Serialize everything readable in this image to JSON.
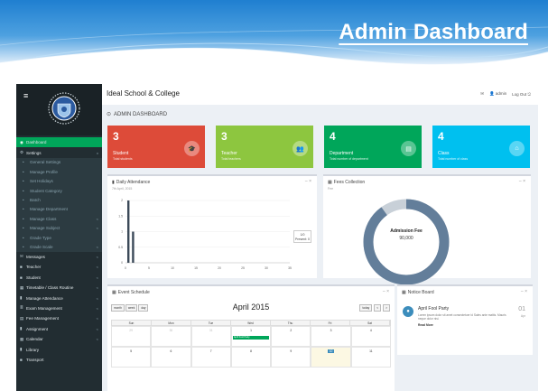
{
  "banner": {
    "title": "Admin Dashboard",
    "colors": {
      "top": "#1f7fd0",
      "bottom": "#e6f1fb"
    }
  },
  "app": {
    "school_name": "Ideal School & College",
    "page_title": "ADMIN DASHBOARD",
    "topbar": {
      "mail_icon": "envelope-icon",
      "user": "admin",
      "logout": "Log Out"
    }
  },
  "sidebar": {
    "items": [
      {
        "label": "Dashboard",
        "icon": "dashboard-icon",
        "state": "active"
      },
      {
        "label": "Settings",
        "icon": "gear-icon",
        "state": "open",
        "chevron": "v"
      },
      {
        "label": "General Settings",
        "sub": true
      },
      {
        "label": "Manage Profile",
        "sub": true
      },
      {
        "label": "Set Holidays",
        "sub": true
      },
      {
        "label": "Student Category",
        "sub": true
      },
      {
        "label": "Batch",
        "sub": true
      },
      {
        "label": "Manage Department",
        "sub": true
      },
      {
        "label": "Manage Class",
        "sub": true,
        "chevron": "<"
      },
      {
        "label": "Manage Subject",
        "sub": true,
        "chevron": "<"
      },
      {
        "label": "Grade Type",
        "sub": true
      },
      {
        "label": "Grade Scale",
        "sub": true,
        "chevron": "<"
      },
      {
        "label": "Messages",
        "icon": "envelope-icon",
        "chevron": "<"
      },
      {
        "label": "Teacher",
        "icon": "user-icon",
        "chevron": "<"
      },
      {
        "label": "Student",
        "icon": "users-icon",
        "chevron": "<"
      },
      {
        "label": "Timetable / Class Routine",
        "icon": "table-icon",
        "chevron": "<"
      },
      {
        "label": "Manage Attendance",
        "icon": "chart-icon",
        "chevron": "<"
      },
      {
        "label": "Exam Management",
        "icon": "list-icon",
        "chevron": "<"
      },
      {
        "label": "Fee Management",
        "icon": "money-icon",
        "chevron": "<"
      },
      {
        "label": "Assignment",
        "icon": "book-icon",
        "chevron": "<"
      },
      {
        "label": "Calendar",
        "icon": "calendar-icon",
        "chevron": "<"
      },
      {
        "label": "Library",
        "icon": "book-icon"
      },
      {
        "label": "Transport",
        "icon": "bus-icon"
      }
    ]
  },
  "stats": [
    {
      "number": "3",
      "label": "Student",
      "sub": "Total students",
      "color": "#dd4b39",
      "icon": "graduation-cap-icon"
    },
    {
      "number": "3",
      "label": "Teacher",
      "sub": "Total teachers",
      "color": "#8dc63f",
      "icon": "teacher-icon"
    },
    {
      "number": "4",
      "label": "Department",
      "sub": "Total number of department",
      "color": "#00a65a",
      "icon": "building-icon"
    },
    {
      "number": "4",
      "label": "Class",
      "sub": "Total number of class",
      "color": "#00c0ef",
      "icon": "class-icon"
    }
  ],
  "attendance": {
    "title": "Daily Attendance",
    "subtitle": "7th April, 2015",
    "tools": "– ×",
    "legend_value": "1/0",
    "legend_label": "Present: 0"
  },
  "chart_data": {
    "type": "bar",
    "x": [
      0,
      1
    ],
    "values": [
      2,
      1
    ],
    "x_ticks": [
      "0",
      "5",
      "10",
      "15",
      "20",
      "25",
      "30",
      "35"
    ],
    "y_ticks": [
      "0",
      "0.5",
      "1",
      "1.5",
      "2"
    ],
    "xlim": [
      0,
      35
    ],
    "ylim": [
      0,
      2
    ],
    "grid": true,
    "color": "#3c4a59"
  },
  "fees": {
    "title": "Fees Collection",
    "subtitle": "Fee",
    "tools": "– ×",
    "center_label": "Admission Fee",
    "center_value": "90,000",
    "collected_fraction": 0.9,
    "colors": {
      "main": "#637e9a",
      "other": "#c8d0d8"
    }
  },
  "schedule": {
    "title": "Event Schedule",
    "tools": "– ×",
    "month": "April 2015",
    "view_buttons": [
      "month",
      "week",
      "day"
    ],
    "nav_buttons": [
      "today",
      "<",
      ">"
    ],
    "weekdays": [
      "Sun",
      "Mon",
      "Tue",
      "Wed",
      "Thu",
      "Fri",
      "Sat"
    ],
    "weeks": [
      [
        "29",
        "30",
        "31",
        "1",
        "2",
        "3",
        "4"
      ],
      [
        "5",
        "6",
        "7",
        "8",
        "9",
        "10",
        "11"
      ]
    ],
    "event": {
      "label": "April Fool Party",
      "week": 0,
      "day": 3
    },
    "today": {
      "week": 1,
      "day": 5
    }
  },
  "notice": {
    "title": "Notice Board",
    "tools": "– ×",
    "item_title": "April Fool Party",
    "item_text": "Lorem ipsum dolor sit amet consectetuer id Sales ante mattis. Mauris neque dolor nisi.",
    "read_more": "Read More",
    "day": "01",
    "month": "Apr"
  }
}
